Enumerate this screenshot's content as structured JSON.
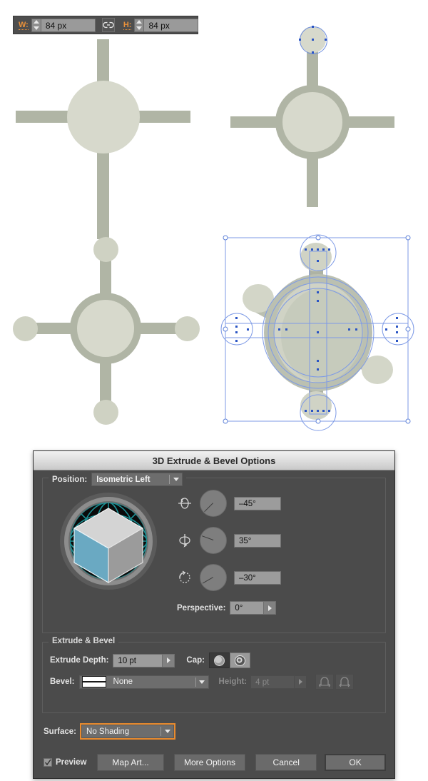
{
  "toolbar": {
    "width_label": "W:",
    "width_value": "84 px",
    "height_label": "H:",
    "height_value": "84 px",
    "link_icon": "link-chain-icon",
    "constrain_linked": true
  },
  "artboard": {
    "shapes": [
      {
        "name": "crosshair-plain",
        "description": "circle hub with four straight bars"
      },
      {
        "name": "crosshair-ringed",
        "description": "ringed hub with four bars and one small selected circle on top bar"
      },
      {
        "name": "crosshair-balled",
        "description": "ringed hub with four bars ending in round balls"
      },
      {
        "name": "crosshair-extruded-selected",
        "description": "3D rotated version with selection bounding box and anchor points"
      }
    ],
    "fill_light": "#d7d9cc",
    "fill_mid": "#b0b5a5",
    "selection_blue": "#7d9ae6",
    "anchor_blue": "#2b55c4"
  },
  "dialog": {
    "title": "3D Extrude & Bevel Options",
    "position": {
      "label": "Position:",
      "preset": "Isometric Left",
      "preview_icon": "isometric-cube-preview",
      "cube_top_color": "#d4d4d4",
      "cube_left_color": "#6aa9c2",
      "cube_right_color": "#9b9b9b",
      "wireframe_color": "#1c8f93",
      "rotations": [
        {
          "axis_icon": "rotate-x-axis-icon",
          "value": "–45°",
          "needle_deg": 135
        },
        {
          "axis_icon": "rotate-y-axis-icon",
          "value": "35°",
          "needle_deg": 200
        },
        {
          "axis_icon": "rotate-z-axis-icon",
          "value": "–30°",
          "needle_deg": 150
        }
      ],
      "perspective_label": "Perspective:",
      "perspective_value": "0°"
    },
    "extrude": {
      "legend": "Extrude & Bevel",
      "depth_label": "Extrude Depth:",
      "depth_value": "10 pt",
      "cap_label": "Cap:",
      "cap_solid_icon": "cap-solid-icon",
      "cap_hollow_icon": "cap-hollow-icon",
      "cap_selected": "hollow",
      "bevel_label": "Bevel:",
      "bevel_value": "None",
      "bevel_swatch_icon": "bevel-profile-none-icon",
      "height_label": "Height:",
      "height_value": "4 pt",
      "height_disabled": true,
      "bevel_extent_out_icon": "bevel-extent-out-icon",
      "bevel_extent_in_icon": "bevel-extent-in-icon"
    },
    "surface": {
      "label": "Surface:",
      "value": "No Shading",
      "focused": true,
      "focus_color": "#e98b2e"
    },
    "footer": {
      "preview_label": "Preview",
      "preview_checked": true,
      "map_art_label": "Map Art...",
      "more_options_label": "More Options",
      "cancel_label": "Cancel",
      "ok_label": "OK"
    }
  }
}
